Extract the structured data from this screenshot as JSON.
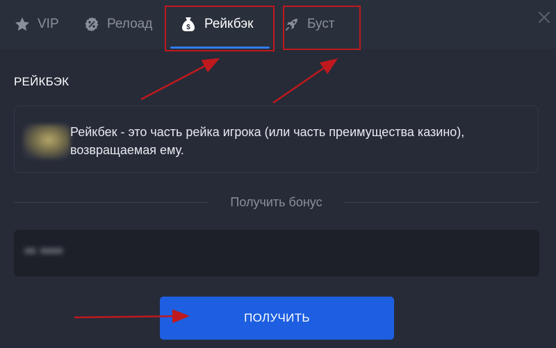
{
  "tabs": [
    {
      "label": "VIP",
      "icon": "star-icon"
    },
    {
      "label": "Релоад",
      "icon": "percent-badge-icon"
    },
    {
      "label": "Рейкбэк",
      "icon": "money-bag-icon",
      "active": true
    },
    {
      "label": "Буст",
      "icon": "rocket-icon"
    }
  ],
  "close_icon": "close-icon",
  "section": {
    "title": "РЕЙКБЭК",
    "description": "Рейкбек - это часть рейка игрока (или часть преимущества казино), возвращаемая ему."
  },
  "bonus": {
    "divider_label": "Получить бонус",
    "code_value": "•• ••••",
    "button_label": "ПОЛУЧИТЬ"
  },
  "colors": {
    "background": "#272b38",
    "accent": "#2f7ef5",
    "button": "#1d5fe0",
    "annotation": "#c0191d"
  }
}
